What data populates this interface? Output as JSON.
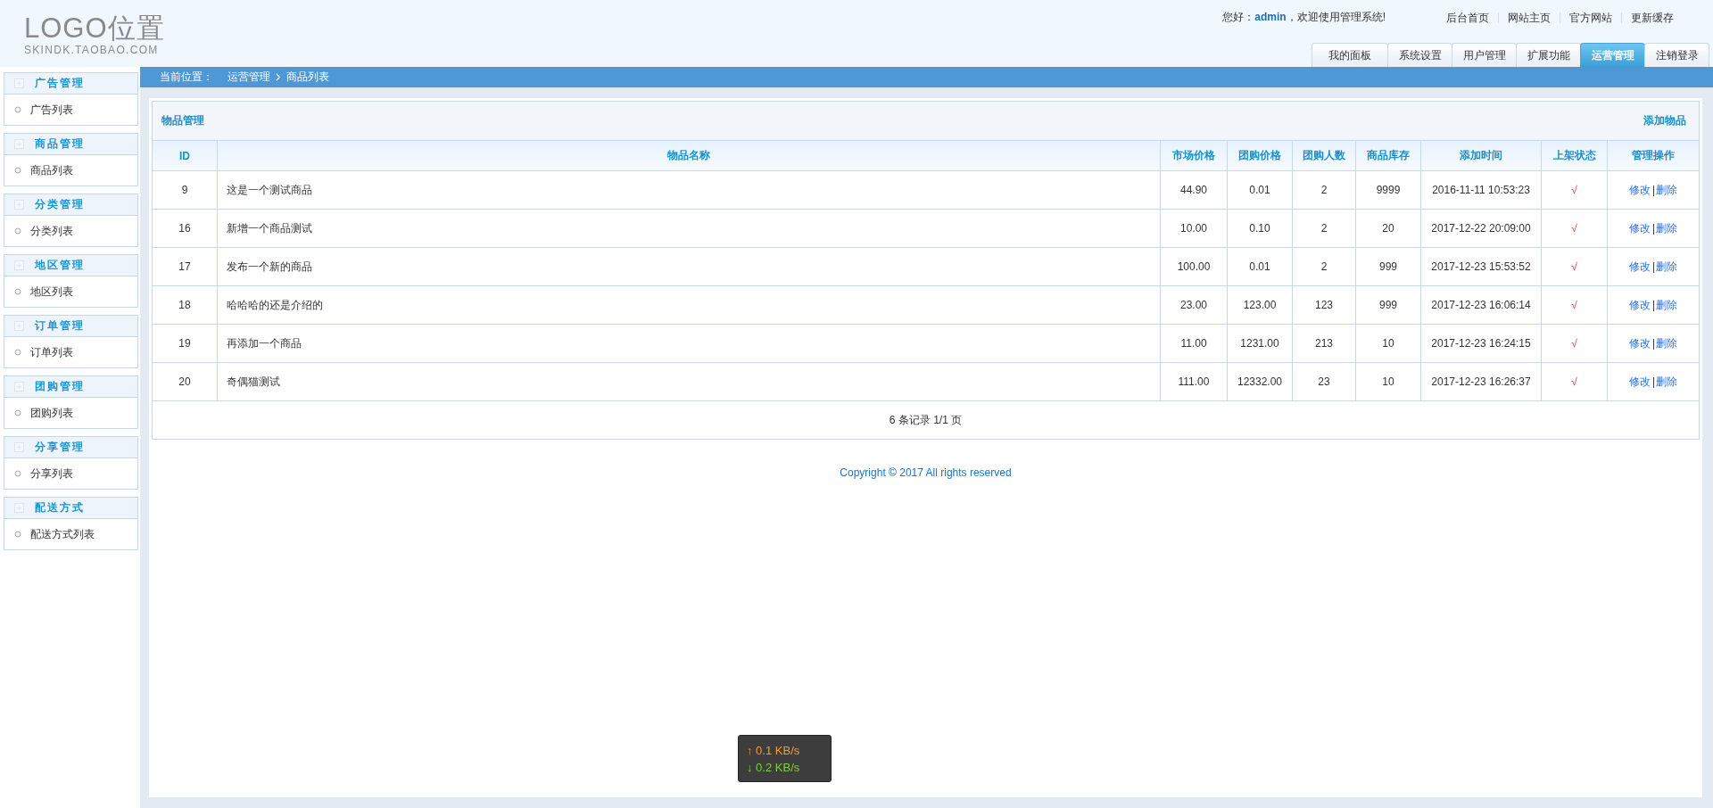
{
  "logo": {
    "title": "LOGO位置",
    "subtitle": "SKINDK.TAOBAO.COM"
  },
  "greeting": "您好：**admin**，欢迎使用管理系统!",
  "top_links": [
    {
      "label": "后台首页"
    },
    {
      "label": "网站主页"
    },
    {
      "label": "官方网站"
    },
    {
      "label": "更新缓存"
    }
  ],
  "tabs": [
    {
      "label": "我的面板",
      "selected": false
    },
    {
      "label": "系统设置",
      "selected": false
    },
    {
      "label": "用户管理",
      "selected": false
    },
    {
      "label": "扩展功能",
      "selected": false
    },
    {
      "label": "运营管理",
      "selected": true
    },
    {
      "label": "注销登录",
      "selected": false
    }
  ],
  "breadcrumb": {
    "label": "当前位置：",
    "items": [
      "运营管理",
      "商品列表"
    ]
  },
  "sidebar": {
    "groups": [
      {
        "title": "广告管理",
        "items": [
          "广告列表"
        ]
      },
      {
        "title": "商品管理",
        "items": [
          "商品列表"
        ]
      },
      {
        "title": "分类管理",
        "items": [
          "分类列表"
        ]
      },
      {
        "title": "地区管理",
        "items": [
          "地区列表"
        ]
      },
      {
        "title": "订单管理",
        "items": [
          "订单列表"
        ]
      },
      {
        "title": "团购管理",
        "items": [
          "团购列表"
        ]
      },
      {
        "title": "分享管理",
        "items": [
          "分享列表"
        ]
      },
      {
        "title": "配送方式",
        "items": [
          "配送方式列表"
        ]
      }
    ]
  },
  "panel": {
    "title": "物品管理",
    "add_link": "添加物品"
  },
  "table": {
    "columns": [
      "ID",
      "物品名称",
      "市场价格",
      "团购价格",
      "团购人数",
      "商品库存",
      "添加时间",
      "上架状态",
      "管理操作"
    ],
    "rows": [
      {
        "id": "9",
        "name": "这是一个测试商品",
        "market_price": "44.90",
        "group_price": "0.01",
        "buyers": "2",
        "stock": "9999",
        "added": "2016-11-11 10:53:23",
        "status": "√",
        "edit": "修改",
        "separator": "|",
        "delete": "删除"
      },
      {
        "id": "16",
        "name": "新增一个商品测试",
        "market_price": "10.00",
        "group_price": "0.10",
        "buyers": "2",
        "stock": "20",
        "added": "2017-12-22 20:09:00",
        "status": "√",
        "edit": "修改",
        "separator": "|",
        "delete": "删除"
      },
      {
        "id": "17",
        "name": "发布一个新的商品",
        "market_price": "100.00",
        "group_price": "0.01",
        "buyers": "2",
        "stock": "999",
        "added": "2017-12-23 15:53:52",
        "status": "√",
        "edit": "修改",
        "separator": "|",
        "delete": "删除"
      },
      {
        "id": "18",
        "name": "哈哈哈的还是介绍的",
        "market_price": "23.00",
        "group_price": "123.00",
        "buyers": "123",
        "stock": "999",
        "added": "2017-12-23 16:06:14",
        "status": "√",
        "edit": "修改",
        "separator": "|",
        "delete": "删除"
      },
      {
        "id": "19",
        "name": "再添加一个商品",
        "market_price": "11.00",
        "group_price": "1231.00",
        "buyers": "213",
        "stock": "10",
        "added": "2017-12-23 16:24:15",
        "status": "√",
        "edit": "修改",
        "separator": "|",
        "delete": "删除"
      },
      {
        "id": "20",
        "name": "奇偶猫测试",
        "market_price": "111.00",
        "group_price": "12332.00",
        "buyers": "23",
        "stock": "10",
        "added": "2017-12-23 16:26:37",
        "status": "√",
        "edit": "修改",
        "separator": "|",
        "delete": "删除"
      }
    ],
    "pagination": "6 条记录 1/1 页"
  },
  "footer": "Copyright © 2017 All rights reserved",
  "speed_meter": [
    {
      "arrow": "↑",
      "reading": "0.1 KB/s",
      "color": "#f0a030"
    },
    {
      "arrow": "↓",
      "reading": "0.2 KB/s",
      "color": "#7cd23a"
    }
  ]
}
